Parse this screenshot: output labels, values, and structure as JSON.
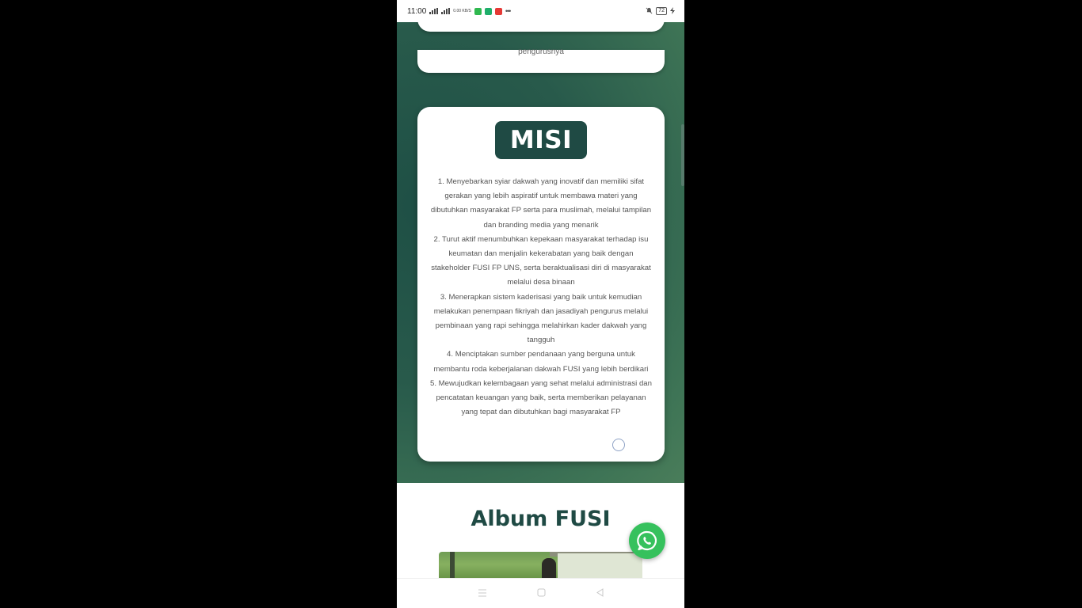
{
  "status_bar": {
    "time": "11:00",
    "network_speed": "0.00 KB/S",
    "battery": "72"
  },
  "previous_card": {
    "text_fragment": "pengurusnya"
  },
  "misi": {
    "heading": "MISI",
    "items": [
      "1. Menyebarkan syiar dakwah yang inovatif dan memiliki sifat gerakan yang lebih aspiratif untuk membawa materi yang dibutuhkan masyarakat FP serta para muslimah, melalui tampilan dan branding media yang menarik",
      "2. Turut aktif menumbuhkan kepekaan masyarakat terhadap isu keumatan dan menjalin kekerabatan yang baik dengan stakeholder FUSI FP UNS, serta beraktualisasi diri di masyarakat melalui desa binaan",
      "3. Menerapkan sistem kaderisasi yang baik untuk kemudian melakukan penempaan fikriyah dan jasadiyah pengurus melalui pembinaan yang rapi sehingga melahirkan kader dakwah yang tangguh",
      "4. Menciptakan sumber pendanaan yang berguna untuk membantu roda keberjalanan dakwah FUSI yang lebih berdikari",
      "5. Mewujudkan kelembagaan yang sehat melalui administrasi dan pencatatan keuangan yang baik, serta memberikan pelayanan yang tepat dan dibutuhkan bagi masyarakat FP"
    ]
  },
  "album": {
    "title": "Album FUSI"
  },
  "icons": {
    "whatsapp": "whatsapp-icon",
    "nav_recents": "recents-icon",
    "nav_home": "home-icon",
    "nav_back": "back-icon"
  },
  "colors": {
    "primary_dark_green": "#1f4a44",
    "whatsapp_green": "#36c15d"
  }
}
